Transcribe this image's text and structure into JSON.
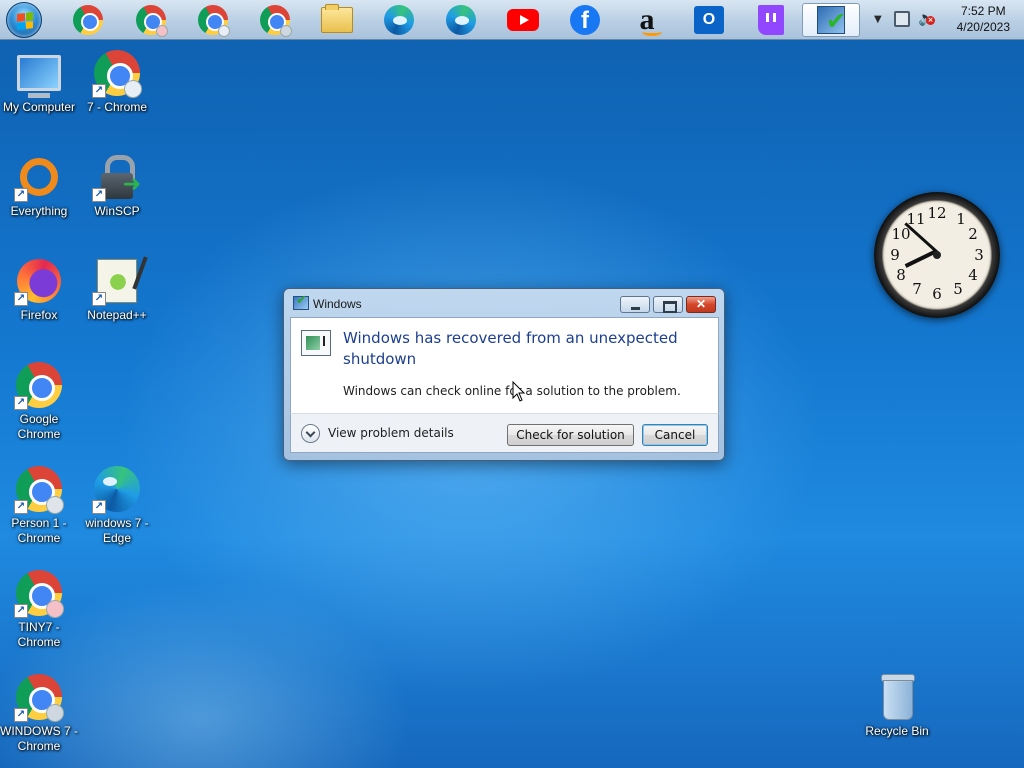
{
  "taskbar": {
    "start_icon": "windows-orb-icon",
    "pinned": [
      {
        "name": "chrome-icon"
      },
      {
        "name": "chrome-profile-icon"
      },
      {
        "name": "chrome-profile-icon"
      },
      {
        "name": "chrome-profile-icon"
      },
      {
        "name": "file-explorer-icon"
      },
      {
        "name": "edge-profile-icon"
      },
      {
        "name": "edge-icon"
      },
      {
        "name": "youtube-icon"
      },
      {
        "name": "facebook-icon"
      },
      {
        "name": "amazon-icon"
      },
      {
        "name": "outlook-icon"
      },
      {
        "name": "twitch-icon"
      },
      {
        "name": "troubleshooter-icon"
      }
    ],
    "tray": {
      "time": "7:52 PM",
      "date": "4/20/2023"
    }
  },
  "desktop": {
    "icons": [
      {
        "label": "My Computer",
        "icon": "computer-icon"
      },
      {
        "label": "7 - Chrome",
        "icon": "chrome-icon"
      },
      {
        "label": "Everything",
        "icon": "everything-icon"
      },
      {
        "label": "WinSCP",
        "icon": "winscp-icon"
      },
      {
        "label": "Firefox",
        "icon": "firefox-icon"
      },
      {
        "label": "Notepad++",
        "icon": "notepad-plus-plus-icon"
      },
      {
        "label": "Google Chrome",
        "icon": "chrome-icon"
      },
      {
        "label": "Person 1 - Chrome",
        "icon": "chrome-icon"
      },
      {
        "label": "windows 7 - Edge",
        "icon": "edge-icon"
      },
      {
        "label": "TINY7 - Chrome",
        "icon": "chrome-icon"
      },
      {
        "label": "WINDOWS 7 - Chrome",
        "icon": "chrome-icon"
      },
      {
        "label": "Recycle Bin",
        "icon": "recycle-bin-icon"
      }
    ]
  },
  "dialog": {
    "title": "Windows",
    "heading": "Windows has recovered from an unexpected shutdown",
    "message": "Windows can check online for a solution to the problem.",
    "details_label": "View problem details",
    "check_button": "Check for solution",
    "cancel_button": "Cancel",
    "close_glyph": "✕"
  },
  "gadget_clock": {
    "numbers": [
      "12",
      "1",
      "2",
      "3",
      "4",
      "5",
      "6",
      "7",
      "8",
      "9",
      "10",
      "11"
    ]
  },
  "colors": {
    "desktop_blue": "#1478d0",
    "dialog_heading": "#1d3f8f",
    "close_red": "#d4472b"
  }
}
